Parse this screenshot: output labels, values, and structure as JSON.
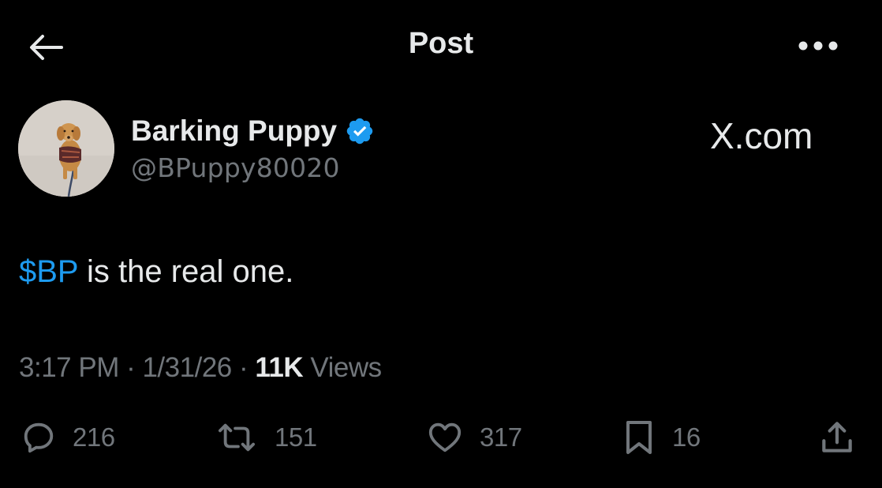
{
  "header": {
    "title": "Post",
    "back_icon": "arrow-left-icon",
    "more_icon": "more-horizontal-icon"
  },
  "author": {
    "name": "Barking Puppy",
    "handle": "@BPuppy80020",
    "verified": true,
    "avatar": "puppy-photo"
  },
  "watermark": "X.com",
  "post": {
    "cashtag": "$BP",
    "text": " is the real one."
  },
  "meta": {
    "time": "3:17 PM",
    "sep1": " · ",
    "date": "1/31/26",
    "sep2": " · ",
    "views_count": "11K",
    "views_label": " Views"
  },
  "actions": {
    "replies": "216",
    "reposts": "151",
    "likes": "317",
    "bookmarks": "16"
  },
  "colors": {
    "background": "#000000",
    "text": "#e7e9ea",
    "muted": "#71767b",
    "accent": "#1d9bf0"
  }
}
